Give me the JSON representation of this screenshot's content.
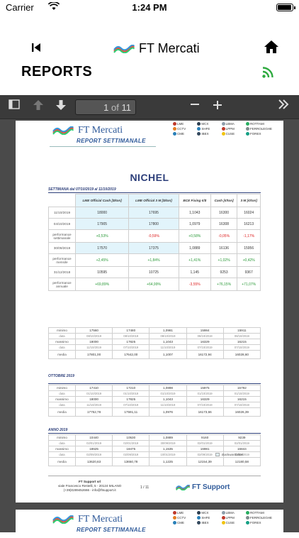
{
  "status": {
    "carrier": "Carrier",
    "time": "1:24 PM"
  },
  "nav": {
    "app_title": "FT Mercati"
  },
  "screen": {
    "title": "REPORTS"
  },
  "viewer": {
    "page_current": "1",
    "page_sep": "of",
    "page_total": "11"
  },
  "report": {
    "brand": "FT Mercati",
    "subtitle": "REPORT SETTIMANALE",
    "metals": [
      "LME",
      "MCX",
      "LBMA",
      "ROTTAMI",
      "CCTV",
      "SHFE",
      "LPPM",
      "FERROLEGHE",
      "CME",
      "IBEX",
      "CUSE",
      "FOREX"
    ],
    "metal": "NICHEL",
    "week_label": "SETTIMANA dal 07/10/2019 al 11/10/2019",
    "columns": [
      "LME Official Cash [$/ton]",
      "LME Official 3 M [$/ton]",
      "BCE Fixing €/$",
      "Cash [€/ton]",
      "3 M [€/ton]"
    ],
    "rows": [
      {
        "label": "11/10/2019",
        "values": [
          "18000",
          "17695",
          "1,1043",
          "16300",
          "16024"
        ],
        "kind": "data"
      },
      {
        "label": "04/10/2019",
        "values": [
          "17905",
          "17800",
          "1,0979",
          "16308",
          "16213"
        ],
        "kind": "data"
      },
      {
        "label": "performance settimanale",
        "values": [
          "+0,53%",
          "-0,59%",
          "+0,58%",
          "-0,05%",
          "-1,17%"
        ],
        "kind": "perf"
      },
      {
        "label": "30/09/2019",
        "values": [
          "17570",
          "17375",
          "1,0889",
          "16136",
          "15956"
        ],
        "kind": "data"
      },
      {
        "label": "performance mensile",
        "values": [
          "+2,45%",
          "+1,84%",
          "+1,41%",
          "+1,02%",
          "+0,42%"
        ],
        "kind": "perf"
      },
      {
        "label": "31/12/2018",
        "values": [
          "10595",
          "10725",
          "1,145",
          "9253",
          "9367"
        ],
        "kind": "data"
      },
      {
        "label": "performance annuale",
        "values": [
          "+69,89%",
          "+64,99%",
          "-3,55%",
          "+76,15%",
          "+71,07%"
        ],
        "kind": "perf"
      }
    ],
    "week_stats": {
      "min": [
        "17560",
        "17480",
        "1,0981",
        "15984",
        "15911"
      ],
      "min_date": [
        "08/10/2019",
        "08/10/2019",
        "08/10/2019",
        "08/10/2019",
        "08/10/2019"
      ],
      "max": [
        "18000",
        "17825",
        "1,1043",
        "16329",
        "16215"
      ],
      "max_date": [
        "11/10/2019",
        "07/10/2019",
        "11/10/2019",
        "07/10/2019",
        "07/10/2019"
      ],
      "media": [
        "17801,00",
        "17642,00",
        "1,1007",
        "16172,94",
        "16028,60"
      ]
    },
    "oct_label": "OTTOBRE 2019",
    "oct_stats": {
      "min": [
        "17410",
        "17210",
        "1,0898",
        "15975",
        "15792"
      ],
      "min_date": [
        "01/10/2019",
        "01/10/2019",
        "01/10/2019",
        "01/10/2019",
        "01/10/2019"
      ],
      "max": [
        "18000",
        "17825",
        "1,1043",
        "16329",
        "16215"
      ],
      "max_date": [
        "11/10/2019",
        "07/10/2019",
        "11/10/2019",
        "07/10/2019",
        "07/10/2019"
      ],
      "media": [
        "17752,78",
        "17591,11",
        "1,0976",
        "16173,66",
        "16026,39"
      ]
    },
    "year_label": "ANNO 2019",
    "year_stats": {
      "min": [
        "10440",
        "10530",
        "1,0889",
        "9160",
        "9239"
      ],
      "min_date": [
        "02/01/2019",
        "02/01/2019",
        "30/09/2019",
        "02/01/2019",
        "02/01/2019"
      ],
      "max": [
        "18625",
        "18475",
        "1,1535",
        "16981",
        "16844"
      ],
      "max_date": [
        "02/09/2019",
        "02/09/2019",
        "10/01/2019",
        "02/09/2019",
        "02/09/2019"
      ],
      "media": [
        "13620,63",
        "13650,78",
        "1,1225",
        "12154,39",
        "12180,58"
      ]
    },
    "stat_labels": {
      "min": "minimo",
      "date": "data",
      "max": "massimo",
      "media": "media"
    },
    "legend": "Backwardation",
    "footer": {
      "company": "FT Support srl",
      "address": "viale Francesco Restelli, 5 - 20124 MILANO",
      "contact": "(+39)0289452666 - info@ftsupport.it",
      "page": "1 / 11",
      "brand": "FT Support"
    }
  }
}
